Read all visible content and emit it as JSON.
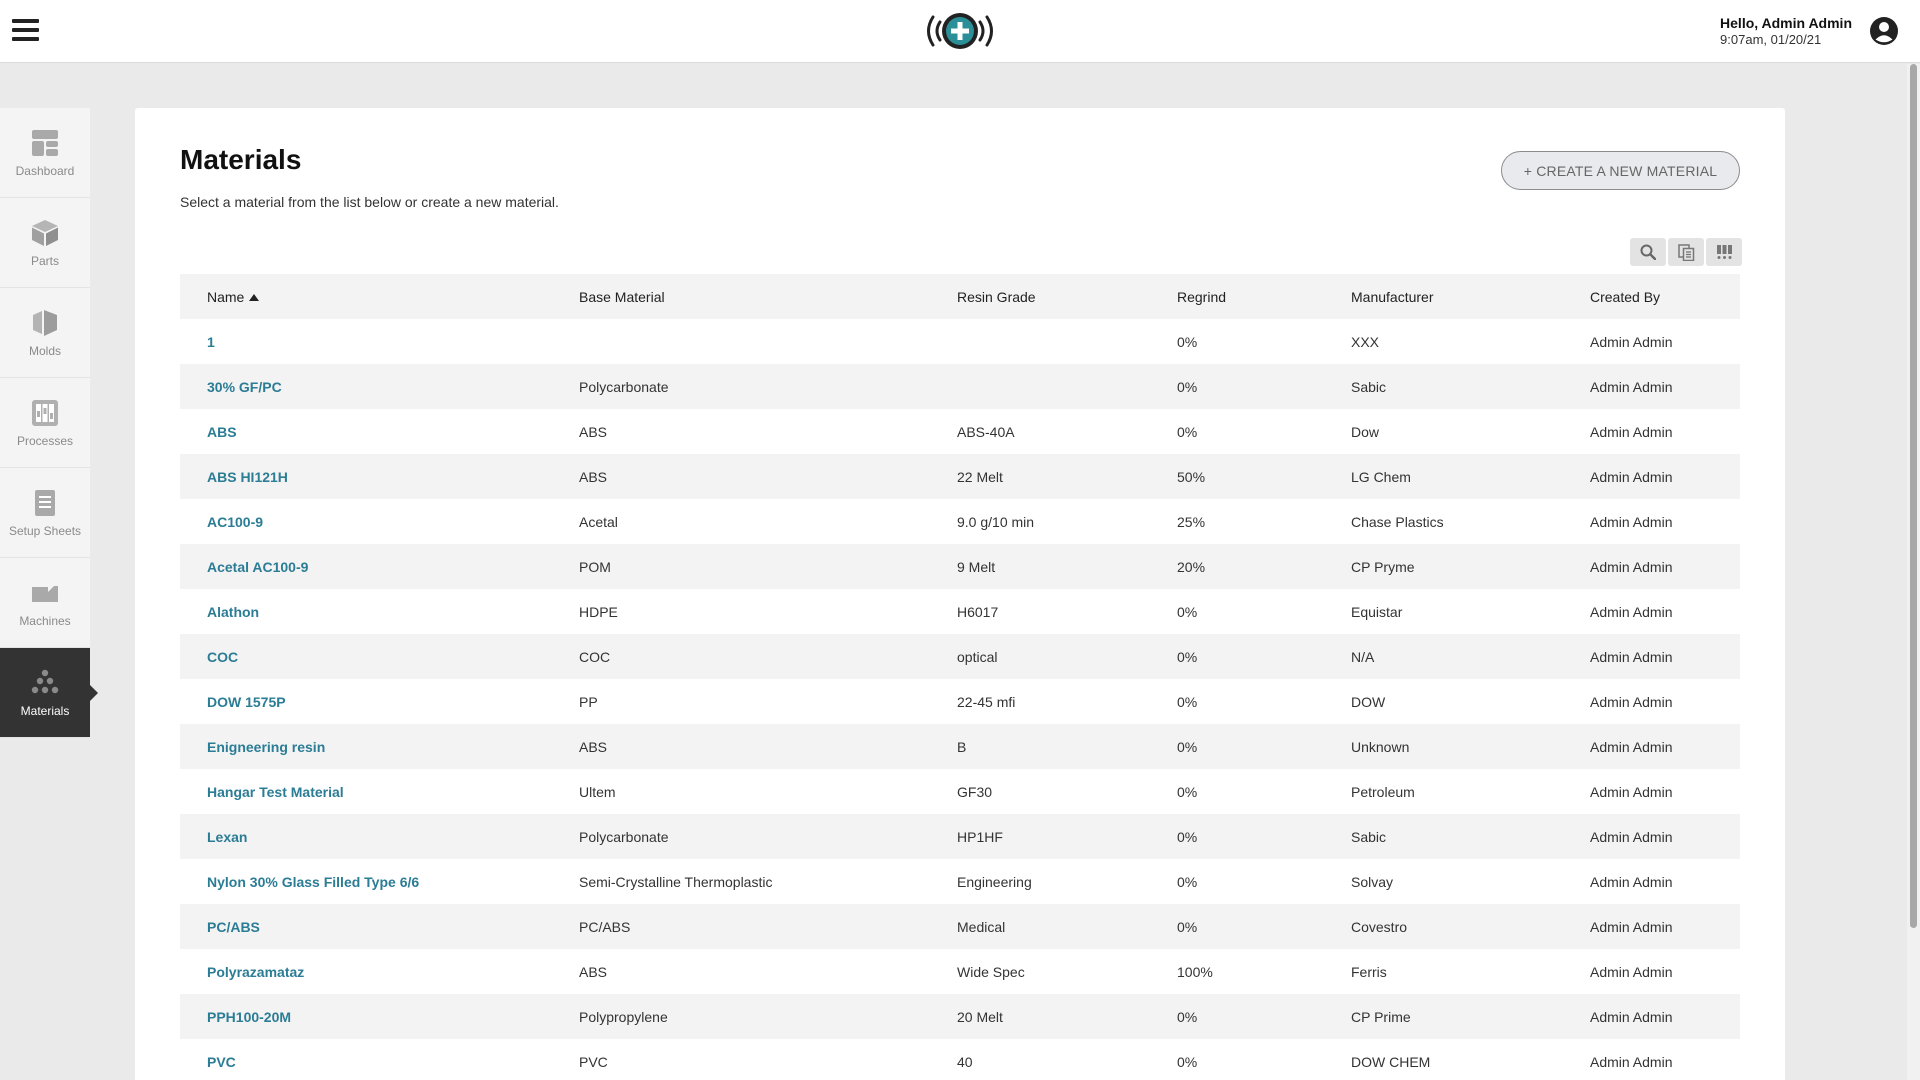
{
  "header": {
    "greeting": "Hello, Admin Admin",
    "datetime": "9:07am, 01/20/21",
    "logo_icon": "plus-signal-logo",
    "menu_icon": "hamburger-icon",
    "user_icon": "user-circle-icon"
  },
  "sidebar": {
    "items": [
      {
        "label": "Dashboard",
        "icon": "dashboard-icon",
        "active": false
      },
      {
        "label": "Parts",
        "icon": "cube-icon",
        "active": false
      },
      {
        "label": "Molds",
        "icon": "mold-icon",
        "active": false
      },
      {
        "label": "Processes",
        "icon": "processes-icon",
        "active": false
      },
      {
        "label": "Setup Sheets",
        "icon": "document-icon",
        "active": false
      },
      {
        "label": "Machines",
        "icon": "machine-icon",
        "active": false
      },
      {
        "label": "Materials",
        "icon": "materials-icon",
        "active": true
      }
    ]
  },
  "main": {
    "title": "Materials",
    "subtitle": "Select a material from the list below or create a new material.",
    "create_button": "+ CREATE A NEW MATERIAL",
    "toolbar": [
      "search-icon",
      "copy-icon",
      "columns-icon"
    ]
  },
  "table": {
    "columns": [
      "Name",
      "Base Material",
      "Resin Grade",
      "Regrind",
      "Manufacturer",
      "Created By"
    ],
    "sort_column": "Name",
    "rows": [
      [
        "1",
        "",
        "",
        "0%",
        "XXX",
        "Admin Admin"
      ],
      [
        "30% GF/PC",
        "Polycarbonate",
        "",
        "0%",
        "Sabic",
        "Admin Admin"
      ],
      [
        "ABS",
        "ABS",
        "ABS-40A",
        "0%",
        "Dow",
        "Admin Admin"
      ],
      [
        "ABS HI121H",
        "ABS",
        "22 Melt",
        "50%",
        "LG Chem",
        "Admin Admin"
      ],
      [
        "AC100-9",
        "Acetal",
        "9.0 g/10 min",
        "25%",
        "Chase Plastics",
        "Admin Admin"
      ],
      [
        "Acetal AC100-9",
        "POM",
        "9 Melt",
        "20%",
        "CP Pryme",
        "Admin Admin"
      ],
      [
        "Alathon",
        "HDPE",
        "H6017",
        "0%",
        "Equistar",
        "Admin Admin"
      ],
      [
        "COC",
        "COC",
        "optical",
        "0%",
        "N/A",
        "Admin Admin"
      ],
      [
        "DOW 1575P",
        "PP",
        "22-45 mfi",
        "0%",
        "DOW",
        "Admin Admin"
      ],
      [
        "Enigneering resin",
        "ABS",
        "B",
        "0%",
        "Unknown",
        "Admin Admin"
      ],
      [
        "Hangar Test Material",
        "Ultem",
        "GF30",
        "0%",
        "Petroleum",
        "Admin Admin"
      ],
      [
        "Lexan",
        "Polycarbonate",
        "HP1HF",
        "0%",
        "Sabic",
        "Admin Admin"
      ],
      [
        "Nylon 30% Glass Filled Type 6/6",
        "Semi-Crystalline Thermoplastic",
        "Engineering",
        "0%",
        "Solvay",
        "Admin Admin"
      ],
      [
        "PC/ABS",
        "PC/ABS",
        "Medical",
        "0%",
        "Covestro",
        "Admin Admin"
      ],
      [
        "Polyrazamataz",
        "ABS",
        "Wide Spec",
        "100%",
        "Ferris",
        "Admin Admin"
      ],
      [
        "PPH100-20M",
        "Polypropylene",
        "20 Melt",
        "0%",
        "CP Prime",
        "Admin Admin"
      ],
      [
        "PVC",
        "PVC",
        "40",
        "0%",
        "DOW CHEM",
        "Admin Admin"
      ]
    ]
  },
  "colors": {
    "accent_link": "#2b7c95",
    "logo_teal": "#2a8f96",
    "sidebar_active": "#333333"
  }
}
